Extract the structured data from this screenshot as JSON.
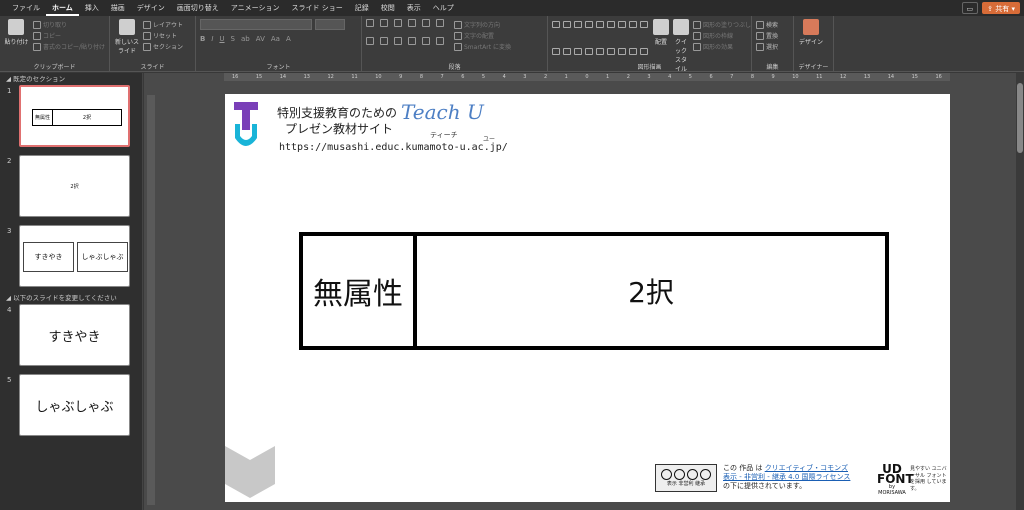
{
  "menubar": {
    "tabs": [
      {
        "label": "ファイル",
        "active": false
      },
      {
        "label": "ホーム",
        "active": true
      },
      {
        "label": "挿入",
        "active": false
      },
      {
        "label": "描画",
        "active": false
      },
      {
        "label": "デザイン",
        "active": false
      },
      {
        "label": "画面切り替え",
        "active": false
      },
      {
        "label": "アニメーション",
        "active": false
      },
      {
        "label": "スライド ショー",
        "active": false
      },
      {
        "label": "記録",
        "active": false
      },
      {
        "label": "校閲",
        "active": false
      },
      {
        "label": "表示",
        "active": false
      },
      {
        "label": "ヘルプ",
        "active": false
      }
    ],
    "share_label": "共有"
  },
  "ribbon": {
    "clipboard": {
      "label": "クリップボード",
      "paste": "貼り付け",
      "cut": "切り取り",
      "copy": "コピー",
      "format_painter": "書式のコピー/貼り付け"
    },
    "slides": {
      "label": "スライド",
      "new_slide": "新しいスライド",
      "layout": "レイアウト",
      "reset": "リセット",
      "section": "セクション"
    },
    "font": {
      "label": "フォント",
      "buttons": [
        "B",
        "I",
        "U",
        "S",
        "ab",
        "AV",
        "Aa",
        "A"
      ]
    },
    "paragraph": {
      "label": "段落",
      "text_direction": "文字列の方向",
      "align_text": "文字の配置",
      "smartart": "SmartArt に変換"
    },
    "drawing": {
      "label": "図形描画",
      "arrange": "配置",
      "quick_styles": "クイックスタイル",
      "fill": "図形の塗りつぶし",
      "outline": "図形の枠線",
      "effects": "図形の効果"
    },
    "editing": {
      "label": "編集",
      "find": "検索",
      "replace": "置換",
      "select": "選択"
    },
    "designer": {
      "label": "デザイナー",
      "button": "デザイン"
    }
  },
  "sidebar": {
    "section1": "既定のセクション",
    "section2": "以下のスライドを変更してください",
    "slides": [
      {
        "num": "1",
        "left": "無属性",
        "right": "2択"
      },
      {
        "num": "2",
        "text": "2択"
      },
      {
        "num": "3",
        "left": "すきやき",
        "right": "しゃぶしゃぶ"
      },
      {
        "num": "4",
        "text": "すきやき"
      },
      {
        "num": "5",
        "text": "しゃぶしゃぶ"
      }
    ]
  },
  "ruler": {
    "ticks": [
      "16",
      "15",
      "14",
      "13",
      "12",
      "11",
      "10",
      "9",
      "8",
      "7",
      "6",
      "5",
      "4",
      "3",
      "2",
      "1",
      "0",
      "1",
      "2",
      "3",
      "4",
      "5",
      "6",
      "7",
      "8",
      "9",
      "10",
      "11",
      "12",
      "13",
      "14",
      "15",
      "16"
    ]
  },
  "slide": {
    "title_line1": "特別支援教育のための",
    "title_line2": "プレゼン教材サイト",
    "brand": "Teach U",
    "brand_kana1": "ティーチ",
    "brand_kana2": "ユー",
    "url": "https://musashi.educ.kumamoto-u.ac.jp/",
    "card_left": "無属性",
    "card_right": "2択",
    "cc_terms": "表示 非営利 継承",
    "license_pre": "この 作品 は ",
    "license_link1": "クリエイティブ・コモンズ",
    "license_link2": "表示 - 非営利 - 継承 4.0 国際ライセンス",
    "license_post": "の下に提供されています。",
    "ud_font": "UD",
    "ud_font_sub": "FONT",
    "ud_font_by": "by MORISAWA",
    "ud_text": "見やすい ユニバーサル フォントを採用 しています。"
  },
  "colors": {
    "accent": "#d86c38",
    "selected_border": "#e07070",
    "brand_blue": "#4d7fc4",
    "logo_purple": "#7a3fb8",
    "logo_cyan": "#19b4d8"
  }
}
